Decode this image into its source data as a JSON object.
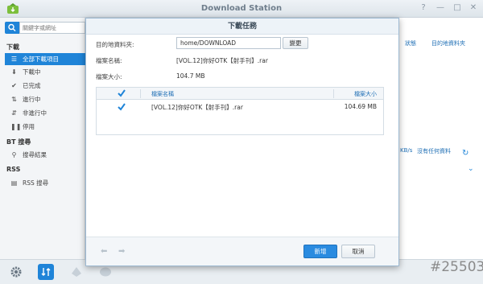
{
  "app": {
    "title": "Download Station"
  },
  "window_controls": [
    "?",
    "—",
    "□",
    "✕"
  ],
  "search": {
    "placeholder": "關鍵字或網址"
  },
  "sidebar": {
    "sections": [
      {
        "heading": "下載"
      },
      {
        "heading": "BT 搜尋"
      },
      {
        "heading": "RSS"
      }
    ],
    "items": [
      {
        "label": "全部下載項目",
        "icon": "list-icon",
        "active": true
      },
      {
        "label": "下載中",
        "icon": "download-arrow-icon"
      },
      {
        "label": "已完成",
        "icon": "checkmark-icon"
      },
      {
        "label": "進行中",
        "icon": "updown-arrows-icon"
      },
      {
        "label": "非進行中",
        "icon": "inactive-arrows-icon"
      },
      {
        "label": "停用",
        "icon": "pause-icon"
      },
      {
        "label": "搜尋結果",
        "icon": "search-icon"
      },
      {
        "label": "RSS 搜尋",
        "icon": "rss-icon"
      }
    ]
  },
  "main": {
    "columns": [
      "狀態",
      "目的地資料夾"
    ],
    "speed_text": "KB/s",
    "no_task_text": "沒有任何資料"
  },
  "dialog": {
    "title": "下載任務",
    "dest_label": "目的地資料夾:",
    "dest_value": "home/DOWNLOAD",
    "change_label": "變更",
    "filename_label": "檔案名稱:",
    "filename_value": "[VOL.12]你好OTK【射手刊】.rar",
    "filesize_label": "檔案大小:",
    "filesize_value": "104.7 MB",
    "table": {
      "headers": {
        "name": "檔案名稱",
        "size": "檔案大小"
      },
      "rows": [
        {
          "name": "[VOL.12]你好OTK【射手刊】.rar",
          "size": "104.69 MB",
          "checked": true
        }
      ]
    },
    "ok_label": "新增",
    "cancel_label": "取消"
  },
  "watermark": "#25503",
  "colors": {
    "accent": "#1f84d8",
    "header_text": "#1f6fb5"
  }
}
